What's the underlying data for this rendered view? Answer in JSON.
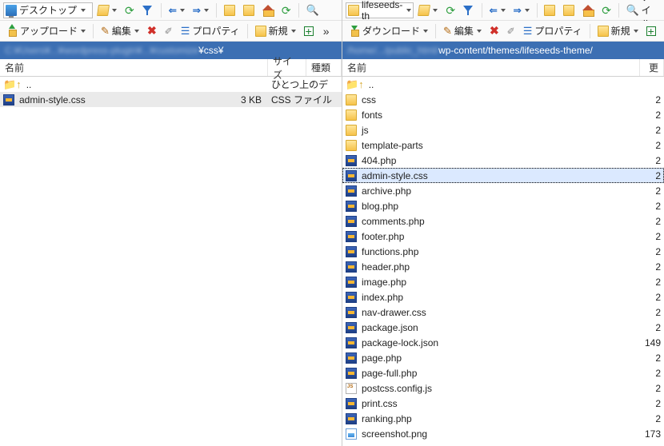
{
  "left": {
    "combo": "デスクトップ",
    "toolbar2": {
      "upload": "アップロード",
      "edit": "編集",
      "properties": "プロパティ",
      "new": "新規"
    },
    "path_hidden": "C:¥Users¥...¥wordpress-plugin¥...¥customize",
    "path_tail": "¥css¥",
    "columns": {
      "name": "名前",
      "size": "サイズ",
      "type": "種類"
    },
    "updir": "..",
    "updir_type": "ひとつ上のデ",
    "files": [
      {
        "icon": "css",
        "name": "admin-style.css",
        "size": "3 KB",
        "type": "CSS ファイル",
        "selected": true
      }
    ]
  },
  "right": {
    "combo": "lifeseeds-th",
    "toolbar_extra": "ファイルの",
    "toolbar2": {
      "download": "ダウンロード",
      "edit": "編集",
      "properties": "プロパティ",
      "new": "新規"
    },
    "path_hidden": "/home/.../public_html/",
    "path_tail": "wp-content/themes/lifeseeds-theme/",
    "columns": {
      "name": "名前",
      "last": "更"
    },
    "updir": "..",
    "files": [
      {
        "icon": "folder",
        "name": "css",
        "right": "2"
      },
      {
        "icon": "folder",
        "name": "fonts",
        "right": "2"
      },
      {
        "icon": "folder",
        "name": "js",
        "right": "2"
      },
      {
        "icon": "folder",
        "name": "template-parts",
        "right": "2"
      },
      {
        "icon": "php",
        "name": "404.php",
        "right": "2"
      },
      {
        "icon": "css",
        "name": "admin-style.css",
        "right": "2",
        "selected": true
      },
      {
        "icon": "php",
        "name": "archive.php",
        "right": "2"
      },
      {
        "icon": "php",
        "name": "blog.php",
        "right": "2"
      },
      {
        "icon": "php",
        "name": "comments.php",
        "right": "2"
      },
      {
        "icon": "php",
        "name": "footer.php",
        "right": "2"
      },
      {
        "icon": "php",
        "name": "functions.php",
        "right": "2"
      },
      {
        "icon": "php",
        "name": "header.php",
        "right": "2"
      },
      {
        "icon": "php",
        "name": "image.php",
        "right": "2"
      },
      {
        "icon": "php",
        "name": "index.php",
        "right": "2"
      },
      {
        "icon": "css",
        "name": "nav-drawer.css",
        "right": "2"
      },
      {
        "icon": "json",
        "name": "package.json",
        "right": "2"
      },
      {
        "icon": "json",
        "name": "package-lock.json",
        "right": "149"
      },
      {
        "icon": "php",
        "name": "page.php",
        "right": "2"
      },
      {
        "icon": "php",
        "name": "page-full.php",
        "right": "2"
      },
      {
        "icon": "js",
        "name": "postcss.config.js",
        "right": "2"
      },
      {
        "icon": "css",
        "name": "print.css",
        "right": "2"
      },
      {
        "icon": "php",
        "name": "ranking.php",
        "right": "2"
      },
      {
        "icon": "png",
        "name": "screenshot.png",
        "right": "173"
      }
    ]
  }
}
